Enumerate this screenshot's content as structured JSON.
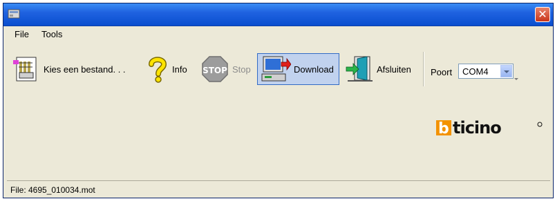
{
  "window": {
    "title": ""
  },
  "menu": {
    "items": [
      "File",
      "Tools"
    ]
  },
  "toolbar": {
    "choose_file": "Kies een bestand. . .",
    "info": "Info",
    "stop": "Stop",
    "download": "Download",
    "exit": "Afsluiten",
    "port_label": "Poort",
    "port_value": "COM4"
  },
  "brand": {
    "logo_text": "bticino",
    "accent_color": "#f39200"
  },
  "status": {
    "text": "File: 4695_010034.mot"
  },
  "colors": {
    "titlebar": "#1f62e0",
    "window_bg": "#ece9d8",
    "active_button": "#c1d2ee"
  }
}
